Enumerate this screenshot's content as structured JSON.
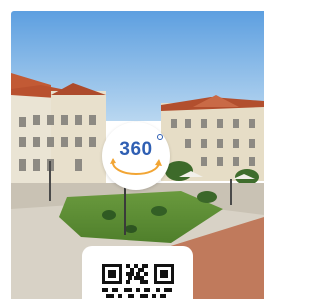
{
  "panorama": {
    "badge_label": "360",
    "badge_icon": "rotate-360-icon",
    "accent_color": "#2f5fb3",
    "arrow_color": "#f2a534"
  },
  "qr": {
    "icon": "qr-code-icon"
  }
}
